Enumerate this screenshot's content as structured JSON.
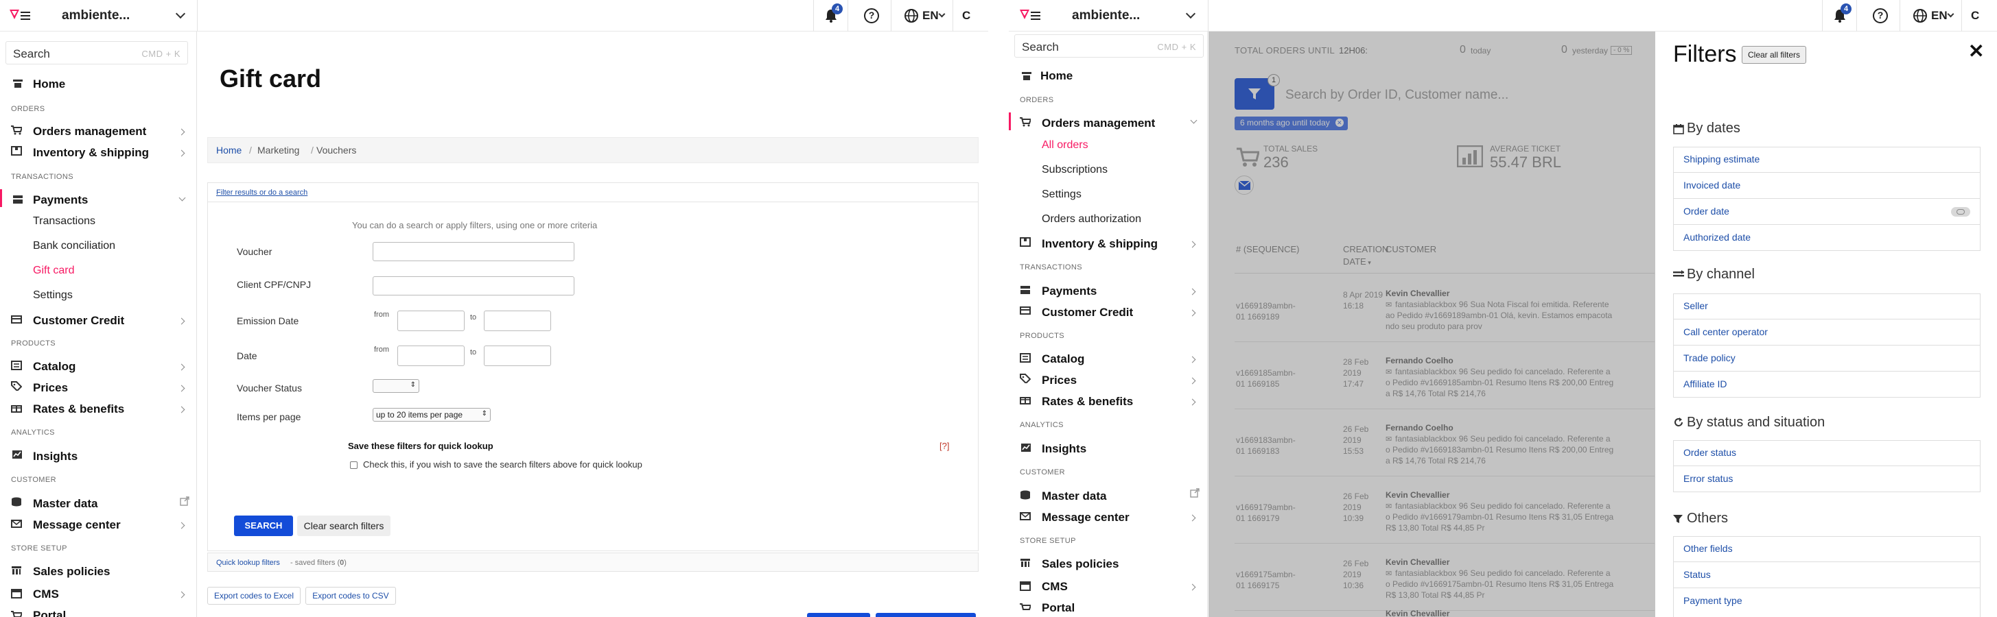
{
  "topbar": {
    "account": "ambiente...",
    "notifications": "4",
    "lang": "EN",
    "user_initial": "C"
  },
  "left": {
    "search": {
      "placeholder": "Search",
      "shortcut": "CMD + K"
    },
    "nav": {
      "home": "Home",
      "sec_orders": "ORDERS",
      "orders_mgmt": "Orders management",
      "inventory": "Inventory & shipping",
      "sec_transactions": "TRANSACTIONS",
      "payments": "Payments",
      "transactions": "Transactions",
      "bank": "Bank conciliation",
      "giftcard": "Gift card",
      "settings": "Settings",
      "customer_credit": "Customer Credit",
      "sec_products": "PRODUCTS",
      "catalog": "Catalog",
      "prices": "Prices",
      "rates": "Rates & benefits",
      "sec_analytics": "ANALYTICS",
      "insights": "Insights",
      "sec_customer": "CUSTOMER",
      "master": "Master data",
      "message": "Message center",
      "sec_store": "STORE SETUP",
      "sales": "Sales policies",
      "cms": "CMS",
      "portal": "Portal"
    },
    "page": {
      "title": "Gift card",
      "crumb_home": "Home",
      "crumb_marketing": "Marketing",
      "crumb_vouchers": "Vouchers",
      "sep": "/",
      "filter_link": "Filter results or do a search",
      "hint": "You can do a search or apply filters, using one or more criteria",
      "voucher": "Voucher",
      "client": "Client CPF/CNPJ",
      "emission": "Emission Date",
      "date": "Date",
      "from": "from",
      "to": "to",
      "status": "Voucher Status",
      "items": "Items per page",
      "items_value": "up to 20 items per page",
      "save_title": "Save these filters for quick lookup",
      "help_q": "[?]",
      "save_check": "Check this, if you wish to save the search filters above for quick lookup",
      "search_btn": "SEARCH",
      "clear_btn": "Clear search filters",
      "quick_link": "Quick lookup filters",
      "quick_saved": " - saved filters (",
      "quick_count": "0",
      "quick_close": ")",
      "export_excel": "Export codes to Excel",
      "export_csv": "Export codes to CSV"
    }
  },
  "right": {
    "search": {
      "placeholder": "Search",
      "shortcut": "CMD + K"
    },
    "nav": {
      "home": "Home",
      "sec_orders": "ORDERS",
      "orders_mgmt": "Orders management",
      "all_orders": "All orders",
      "subscriptions": "Subscriptions",
      "settings": "Settings",
      "orders_auth": "Orders authorization",
      "inventory": "Inventory & shipping",
      "sec_transactions": "TRANSACTIONS",
      "payments": "Payments",
      "customer_credit": "Customer Credit",
      "sec_products": "PRODUCTS",
      "catalog": "Catalog",
      "prices": "Prices",
      "rates": "Rates & benefits",
      "sec_analytics": "ANALYTICS",
      "insights": "Insights",
      "sec_customer": "CUSTOMER",
      "master": "Master data",
      "message": "Message center",
      "sec_store": "STORE SETUP",
      "sales": "Sales policies",
      "cms": "CMS",
      "portal": "Portal"
    },
    "orders": {
      "total_label": "TOTAL ORDERS UNTIL",
      "time": "12H06:",
      "today_val": "0",
      "today_lbl": "today",
      "yest_val": "0",
      "yest_lbl": "yesterday",
      "yest_pct": "- 0 %",
      "filter_count": "1",
      "search_ph": "Search by Order ID, Customer name...",
      "chip": "6 months ago until today",
      "total_sales_lbl": "TOTAL SALES",
      "total_sales_val": "236",
      "avg_lbl": "AVERAGE TICKET",
      "avg_val": "55.47 BRL",
      "col_seq": "# (SEQUENCE)",
      "col_date_1": "CREATION",
      "col_date_2": "DATE",
      "col_customer": "CUSTOMER",
      "rows": [
        {
          "id1": "v1669189ambn-",
          "id2": "01 1669189",
          "d1": "8 Apr 2019",
          "d2": "16:18",
          "d3": "",
          "name": "Kevin Chevallier",
          "l1": "fantasiablackbox 96 Sua Nota Fiscal foi emitida. Referente",
          "l2": "ao Pedido #v1669189ambn-01 Olá, kevin. Estamos empacota",
          "l3": "ndo seu produto para prov"
        },
        {
          "id1": "v1669185ambn-",
          "id2": "01 1669185",
          "d1": "28 Feb",
          "d2": "2019",
          "d3": "17:47",
          "name": "Fernando Coelho",
          "l1": "fantasiablackbox 96 Seu pedido foi cancelado. Referente a",
          "l2": "o Pedido #v1669185ambn-01 Resumo Itens R$ 200,00 Entreg",
          "l3": "a R$ 14,76 Total R$ 214,76"
        },
        {
          "id1": "v1669183ambn-",
          "id2": "01 1669183",
          "d1": "26 Feb",
          "d2": "2019",
          "d3": "15:53",
          "name": "Fernando Coelho",
          "l1": "fantasiablackbox 96 Seu pedido foi cancelado. Referente a",
          "l2": "o Pedido #v1669183ambn-01 Resumo Itens R$ 200,00 Entreg",
          "l3": "a R$ 14,76 Total R$ 214,76"
        },
        {
          "id1": "v1669179ambn-",
          "id2": "01 1669179",
          "d1": "26 Feb",
          "d2": "2019",
          "d3": "10:39",
          "name": "Kevin Chevallier",
          "l1": "fantasiablackbox 96 Seu pedido foi cancelado. Referente a",
          "l2": "o Pedido #v1669179ambn-01 Resumo Itens R$ 31,05 Entrega",
          "l3": "R$ 13,80 Total R$ 44,85 Pr"
        },
        {
          "id1": "v1669175ambn-",
          "id2": "01 1669175",
          "d1": "26 Feb",
          "d2": "2019",
          "d3": "10:36",
          "name": "Kevin Chevallier",
          "l1": "fantasiablackbox 96 Seu pedido foi cancelado. Referente a",
          "l2": "o Pedido #v1669175ambn-01 Resumo Itens R$ 31,05 Entrega",
          "l3": "R$ 13,80 Total R$ 44,85 Pr"
        }
      ],
      "last_name": "Kevin Chevallier"
    },
    "filters": {
      "title": "Filters",
      "clear_all": "Clear all filters",
      "by_dates": "By dates",
      "dates": [
        "Shipping estimate",
        "Invoiced date",
        "Order date",
        "Authorized date"
      ],
      "by_channel": "By channel",
      "channel": [
        "Seller",
        "Call center operator",
        "Trade policy",
        "Affiliate ID"
      ],
      "by_status": "By status and situation",
      "status": [
        "Order status",
        "Error status"
      ],
      "others": "Others",
      "others_items": [
        "Other fields",
        "Status",
        "Payment type"
      ]
    }
  },
  "colors": {
    "brand": "#f71963",
    "link": "#1d4ea8",
    "primary_btn": "#134cd8"
  }
}
